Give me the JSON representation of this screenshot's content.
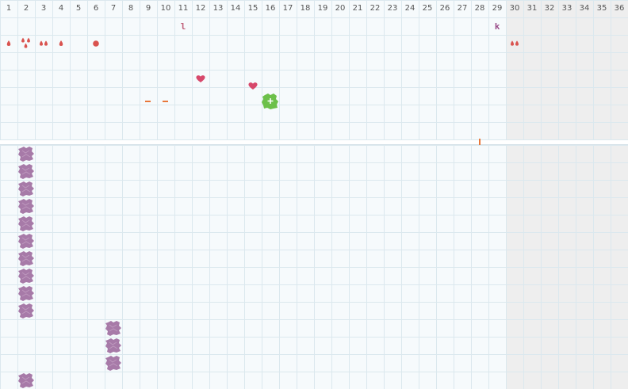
{
  "grid": {
    "column_numbers": [
      "1",
      "2",
      "3",
      "4",
      "5",
      "6",
      "7",
      "8",
      "9",
      "10",
      "11",
      "12",
      "13",
      "14",
      "15",
      "16",
      "17",
      "18",
      "19",
      "20",
      "21",
      "22",
      "23",
      "24",
      "25",
      "26",
      "27",
      "28",
      "29",
      "30",
      "31",
      "32",
      "33",
      "34",
      "35",
      "36"
    ],
    "dim_from_column": "30"
  },
  "colors": {
    "background": "#f6fafc",
    "grid_line": "#dbe8ee",
    "dim_area": "#eeeeee",
    "divider": "#d5e2e8",
    "red_mark": "#d9534f",
    "heart": "#d7486b",
    "dash": "#e8773a",
    "green_piece": "#6cc04a",
    "purple_piece": "#a77aa8",
    "letter_l": "#c0607a",
    "letter_k": "#9b4f8a",
    "tick_orange": "#e8773a"
  },
  "top_section_marks": [
    {
      "kind": "text",
      "icon": "letter-l-icon",
      "text": "l",
      "col": "11",
      "row": 1
    },
    {
      "kind": "text",
      "icon": "letter-k-icon",
      "text": "k",
      "col": "29",
      "row": 1
    },
    {
      "kind": "drop",
      "icon": "drop-icon",
      "col": "1",
      "row": 2
    },
    {
      "kind": "drop-trio",
      "icon": "drop-cluster-icon",
      "col": "2",
      "row": 2
    },
    {
      "kind": "drop-pair",
      "icon": "drop-pair-icon",
      "col": "3",
      "row": 2
    },
    {
      "kind": "drop",
      "icon": "drop-icon",
      "col": "4",
      "row": 2
    },
    {
      "kind": "dot",
      "icon": "dot-icon",
      "col": "6",
      "row": 2
    },
    {
      "kind": "drop-pair",
      "icon": "drop-pair-icon",
      "col": "30",
      "row": 2
    },
    {
      "kind": "heart",
      "icon": "heart-icon",
      "col": "12",
      "row": 4
    },
    {
      "kind": "heart",
      "icon": "heart-icon",
      "col": "15",
      "row": 4.45
    },
    {
      "kind": "dash",
      "icon": "dash-icon",
      "col": "9",
      "row": 5.3
    },
    {
      "kind": "dash",
      "icon": "dash-icon",
      "col": "10",
      "row": 5.3
    },
    {
      "kind": "blob",
      "icon": "green-piece-icon",
      "col": "16",
      "row": 5.3
    },
    {
      "kind": "tick",
      "icon": "tick-icon",
      "col": "28",
      "row": 7.3
    }
  ],
  "bottom_section_pieces": [
    {
      "col": "2",
      "row": 8
    },
    {
      "col": "2",
      "row": 9
    },
    {
      "col": "2",
      "row": 10
    },
    {
      "col": "2",
      "row": 11
    },
    {
      "col": "2",
      "row": 12
    },
    {
      "col": "2",
      "row": 13
    },
    {
      "col": "2",
      "row": 14
    },
    {
      "col": "2",
      "row": 15
    },
    {
      "col": "2",
      "row": 16
    },
    {
      "col": "2",
      "row": 17
    },
    {
      "col": "7",
      "row": 18
    },
    {
      "col": "7",
      "row": 19
    },
    {
      "col": "7",
      "row": 20
    },
    {
      "col": "2",
      "row": 21
    }
  ]
}
